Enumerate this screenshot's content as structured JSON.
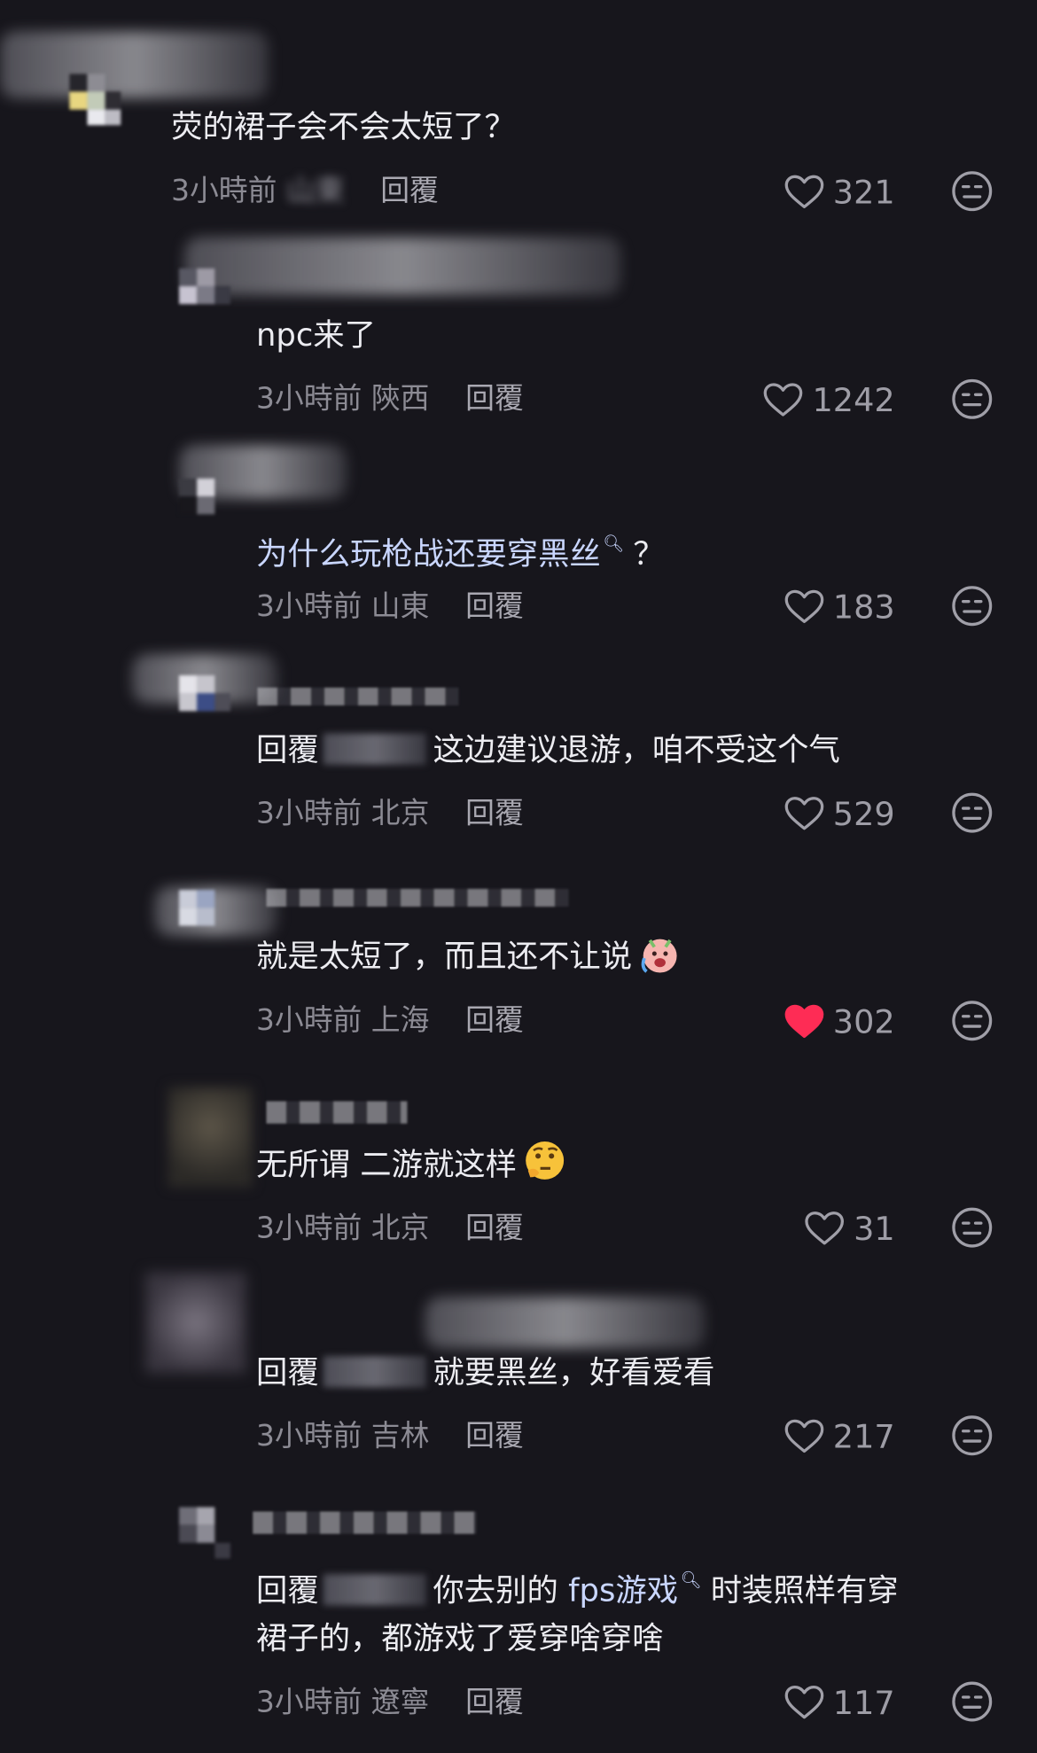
{
  "comments": [
    {
      "text": "荧的裙子会不会太短了？",
      "time": "3小時前",
      "location": "山東",
      "reply_label": "回覆",
      "likes": "321",
      "liked": false
    },
    {
      "text": "npc来了",
      "time": "3小時前",
      "location": "陝西",
      "reply_label": "回覆",
      "likes": "1242",
      "liked": false
    },
    {
      "text": "为什么玩枪战还要穿黑丝",
      "text_suffix": "？",
      "search_mark": "🔍︎",
      "time": "3小時前",
      "location": "山東",
      "reply_label": "回覆",
      "likes": "183",
      "liked": false
    },
    {
      "reply_prefix": "回覆",
      "text": "这边建议退游，咱不受这个气",
      "time": "3小時前",
      "location": "北京",
      "reply_label": "回覆",
      "likes": "529",
      "liked": false
    },
    {
      "text": "就是太短了，而且还不让说",
      "emoji": "crying-face-emoji",
      "time": "3小時前",
      "location": "上海",
      "reply_label": "回覆",
      "likes": "302",
      "liked": true
    },
    {
      "text": "无所谓 二游就这样",
      "emoji": "thinking-face-emoji",
      "time": "3小時前",
      "location": "北京",
      "reply_label": "回覆",
      "likes": "31",
      "liked": false
    },
    {
      "reply_prefix": "回覆",
      "text": "就要黑丝，好看爱看",
      "time": "3小時前",
      "location": "吉林",
      "reply_label": "回覆",
      "likes": "217",
      "liked": false
    },
    {
      "reply_prefix": "回覆",
      "text_pre": "你去别的",
      "link_text": "fps游戏",
      "text_post": "时装照样有穿",
      "text_line2": "裙子的，都游戏了爱穿啥穿啥",
      "time": "3小時前",
      "location": "遼寧",
      "reply_label": "回覆",
      "likes": "117",
      "liked": false
    }
  ],
  "colors": {
    "background": "#17161c",
    "text": "#ececf1",
    "meta": "#8c8b94",
    "link": "#c9d6ff",
    "liked_heart": "#fe2c55"
  },
  "icons": {
    "like": "heart-outline-icon",
    "liked": "heart-filled-icon",
    "react": "neutral-face-icon"
  }
}
